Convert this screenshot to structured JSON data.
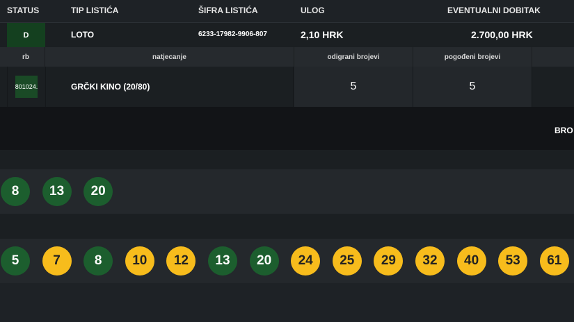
{
  "header": {
    "status": "STATUS",
    "tip": "TIP LISTIĆA",
    "sifra": "ŠIFRA LISTIĆA",
    "ulog": "ULOG",
    "dobitak": "EVENTUALNI DOBITAK"
  },
  "ticket": {
    "status": "D",
    "tip": "LOTO",
    "sifra": "6233-17982-9906-807",
    "ulog": "2,10 HRK",
    "dobitak": "2.700,00 HRK"
  },
  "sub_header": {
    "rb": "rb",
    "natjecanje": "natjecanje",
    "odigrani": "odigrani brojevi",
    "pogodeni": "pogođeni brojevi"
  },
  "event": {
    "rb": "801024.",
    "natjecanje": "GRČKI KINO (20/80)",
    "odigrani": "5",
    "pogodeni": "5"
  },
  "right_label": "BRO",
  "played_numbers": [
    "8",
    "13",
    "20"
  ],
  "drawn_numbers": [
    {
      "n": "5",
      "hit": true
    },
    {
      "n": "7",
      "hit": false
    },
    {
      "n": "8",
      "hit": true
    },
    {
      "n": "10",
      "hit": false
    },
    {
      "n": "12",
      "hit": false
    },
    {
      "n": "13",
      "hit": true
    },
    {
      "n": "20",
      "hit": true
    },
    {
      "n": "24",
      "hit": false
    },
    {
      "n": "25",
      "hit": false
    },
    {
      "n": "29",
      "hit": false
    },
    {
      "n": "32",
      "hit": false
    },
    {
      "n": "40",
      "hit": false
    },
    {
      "n": "53",
      "hit": false
    },
    {
      "n": "61",
      "hit": false
    }
  ],
  "colors": {
    "hit": "#1c5e2e",
    "miss": "#f7bc1c",
    "background": "#1e2226"
  }
}
